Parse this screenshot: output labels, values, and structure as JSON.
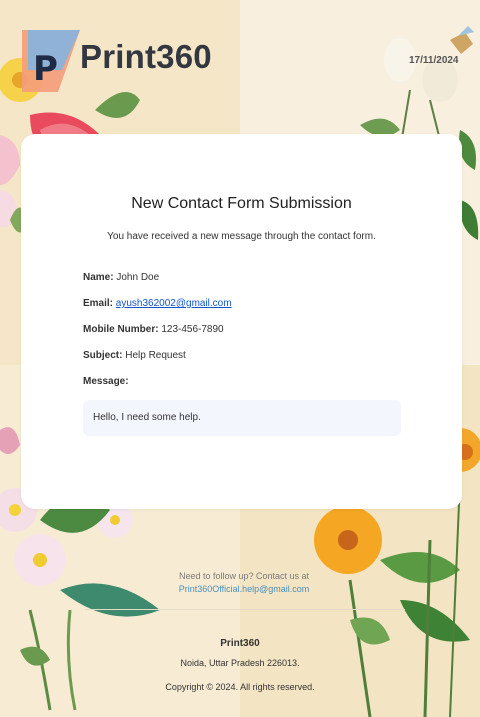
{
  "header": {
    "brand": "Print360",
    "logo_letter": "P",
    "date": "17/11/2024"
  },
  "card": {
    "title": "New Contact Form Submission",
    "subtitle": "You have received a new message through the contact form.",
    "fields": {
      "name_label": "Name:",
      "name_value": "John Doe",
      "email_label": "Email:",
      "email_value": "ayush362002@gmail.com",
      "mobile_label": "Mobile Number:",
      "mobile_value": "123-456-7890",
      "subject_label": "Subject:",
      "subject_value": "Help Request",
      "message_label": "Message:"
    },
    "message": "Hello, I need some help."
  },
  "footer": {
    "follow_text": "Need to follow up? Contact us at ",
    "follow_email": "Print360Official.help@gmail.com",
    "brand": "Print360",
    "address": "Noida, Uttar Pradesh 226013.",
    "copyright": "Copyright © 2024. All rights reserved."
  },
  "colors": {
    "link": "#1155cc",
    "footer_link": "#4a8fb8",
    "card_bg": "#ffffff",
    "message_bg": "#f3f6fd"
  }
}
